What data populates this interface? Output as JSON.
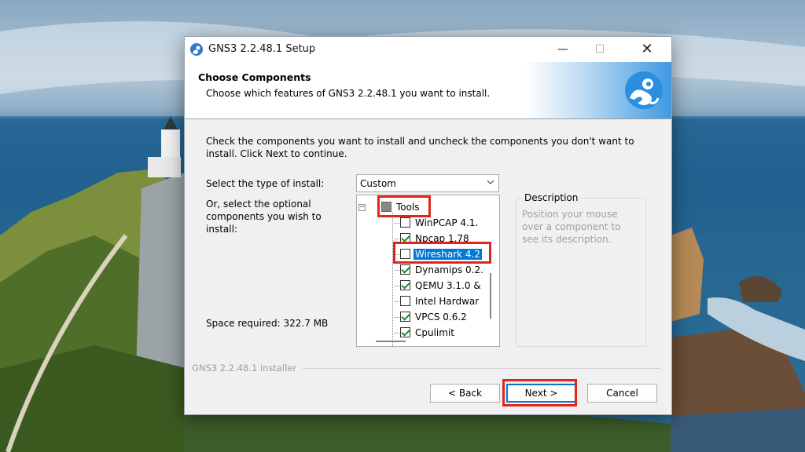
{
  "window": {
    "title": "GNS3 2.2.48.1 Setup",
    "controls": {
      "minimize": "—",
      "maximize": "☐",
      "close": "✕"
    }
  },
  "header": {
    "title": "Choose Components",
    "subtitle": "Choose which features of GNS3 2.2.48.1 you want to install."
  },
  "body": {
    "intro": "Check the components you want to install and uncheck the components you don't want to install. Click Next to continue.",
    "install_type_label": "Select the type of install:",
    "install_type_value": "Custom",
    "select_optional_label": "Or, select the optional components you wish to install:",
    "space_required": "Space required: 322.7 MB"
  },
  "components": {
    "root": {
      "label": "Tools",
      "state": "partial"
    },
    "items": [
      {
        "label": "WinPCAP 4.1.",
        "checked": false,
        "selected": false
      },
      {
        "label": "Npcap 1.78",
        "checked": true,
        "selected": false
      },
      {
        "label": "Wireshark 4.2",
        "checked": false,
        "selected": true
      },
      {
        "label": "Dynamips 0.2.",
        "checked": true,
        "selected": false
      },
      {
        "label": "QEMU 3.1.0 &",
        "checked": true,
        "selected": false
      },
      {
        "label": "Intel Hardwar",
        "checked": false,
        "selected": false
      },
      {
        "label": "VPCS 0.6.2",
        "checked": true,
        "selected": false
      },
      {
        "label": "Cpulimit",
        "checked": true,
        "selected": false
      }
    ]
  },
  "description": {
    "title": "Description",
    "text": "Position your mouse over a component to see its description."
  },
  "footer": {
    "installer_label": "GNS3 2.2.48.1 installer",
    "back_label": "< Back",
    "next_label": "Next >",
    "cancel_label": "Cancel"
  },
  "colors": {
    "highlight_box": "#e1251b",
    "selection": "#0078d7",
    "check": "#1b8a2e"
  }
}
